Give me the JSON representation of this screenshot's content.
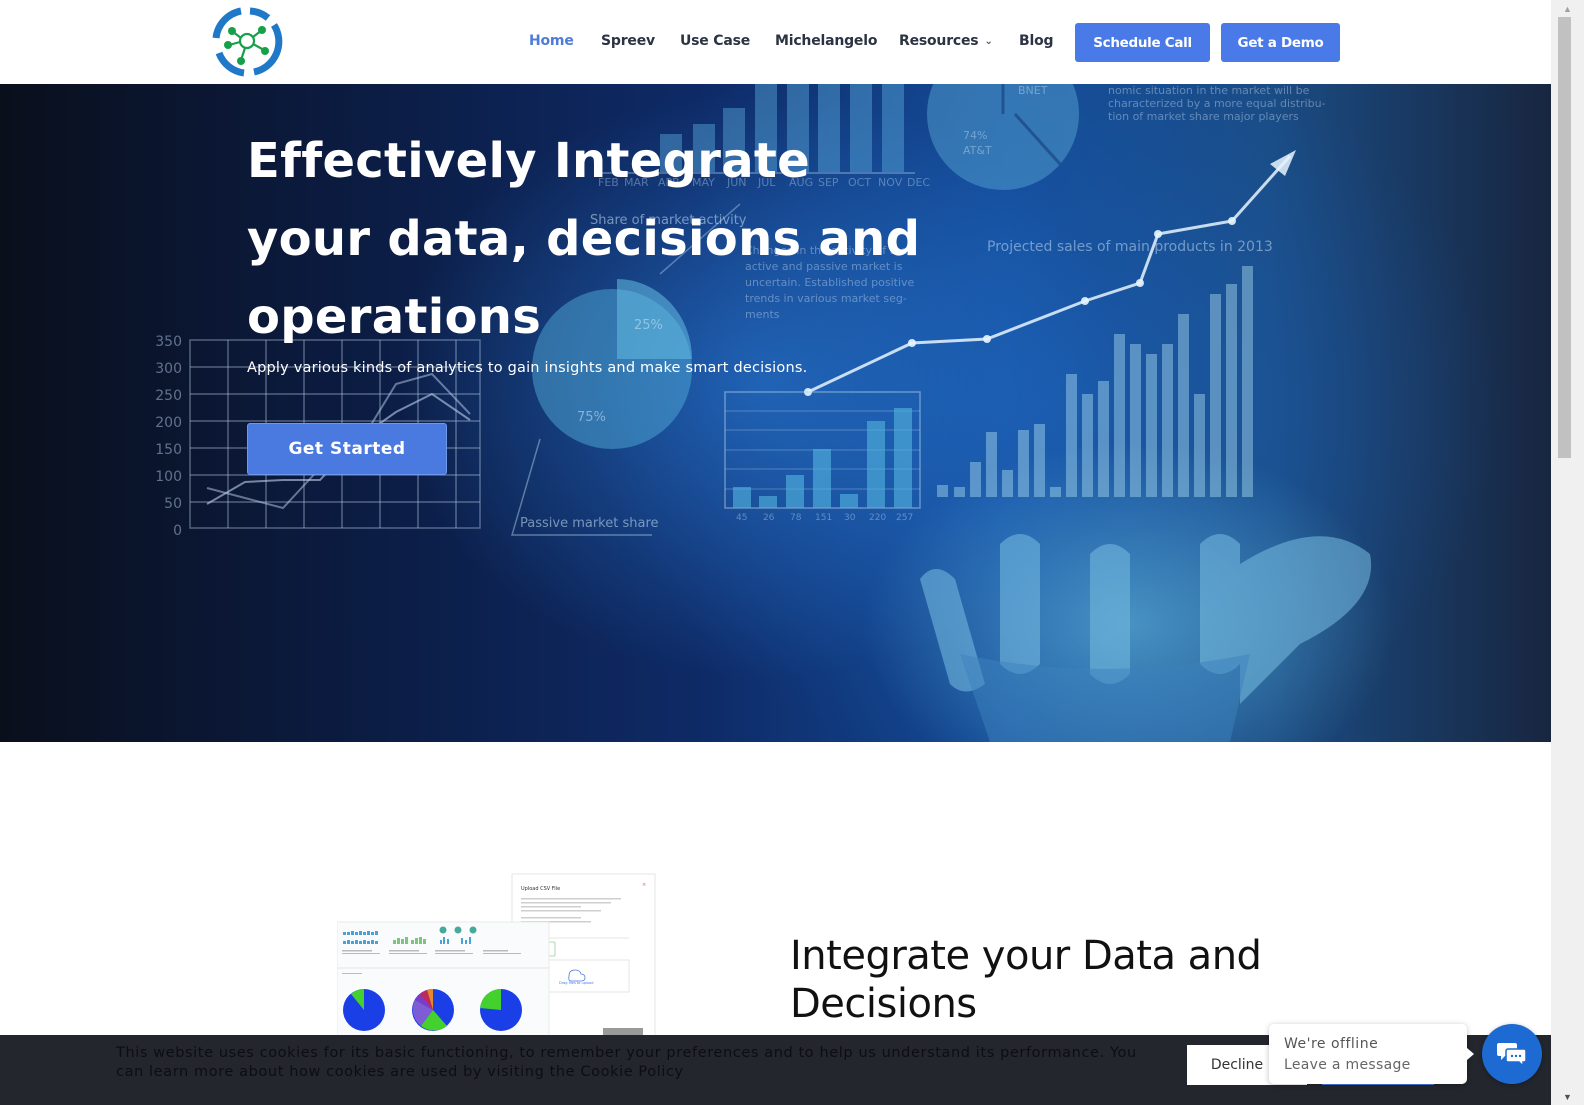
{
  "header": {
    "logo_alt": "Company logo",
    "nav": [
      {
        "label": "Home",
        "active": true
      },
      {
        "label": "Spreev",
        "active": false
      },
      {
        "label": "Use Case",
        "active": false
      },
      {
        "label": "Michelangelo",
        "active": false
      },
      {
        "label": "Resources",
        "active": false,
        "has_dropdown": true
      },
      {
        "label": "Blog",
        "active": false
      }
    ],
    "schedule_call_label": "Schedule Call",
    "get_demo_label": "Get a Demo"
  },
  "hero": {
    "title_lines": [
      "Effectively Integrate",
      "your data, decisions and",
      "operations"
    ],
    "subtitle": "Apply various kinds of analytics to gain insights and make smart decisions.",
    "cta_label": "Get Started",
    "background_text": {
      "line_chart_yticks": [
        "350",
        "300",
        "250",
        "200",
        "150",
        "100",
        "50",
        "0"
      ],
      "months": [
        "FEB",
        "MAR",
        "APR",
        "MAY",
        "JUN",
        "JUL",
        "AUG",
        "SEP",
        "OCT",
        "NOV",
        "DEC"
      ],
      "pie_small_labels": [
        "25%",
        "75%"
      ],
      "pie_small_caption": "Passive market share",
      "pie_large_labels": [
        "74%",
        "AT&T"
      ],
      "pie_title": "Share of market activity",
      "projection_caption": "Projected sales of main products in 2013",
      "bar_labels": [
        "45",
        "26",
        "78",
        "151",
        "30",
        "220",
        "257"
      ]
    }
  },
  "feature": {
    "title": "Integrate your Data and Decisions",
    "mockup": {
      "upload_title": "Upload CSV File",
      "upload_hint": "Drag files to upload"
    }
  },
  "cookie": {
    "text": "This website uses cookies for its basic functioning, to remember your preferences and to help us understand its performance. You can learn more about how cookies are used by visiting the Cookie Policy",
    "decline_label": "Decline"
  },
  "chat": {
    "status": "We're offline",
    "prompt": "Leave a message"
  },
  "colors": {
    "brand_blue": "#4a7ae8",
    "nav_active": "#4f7cd6",
    "chat_blue": "#1c6ad2",
    "logo_ring": "#1f78c8",
    "logo_node": "#16a04a"
  }
}
